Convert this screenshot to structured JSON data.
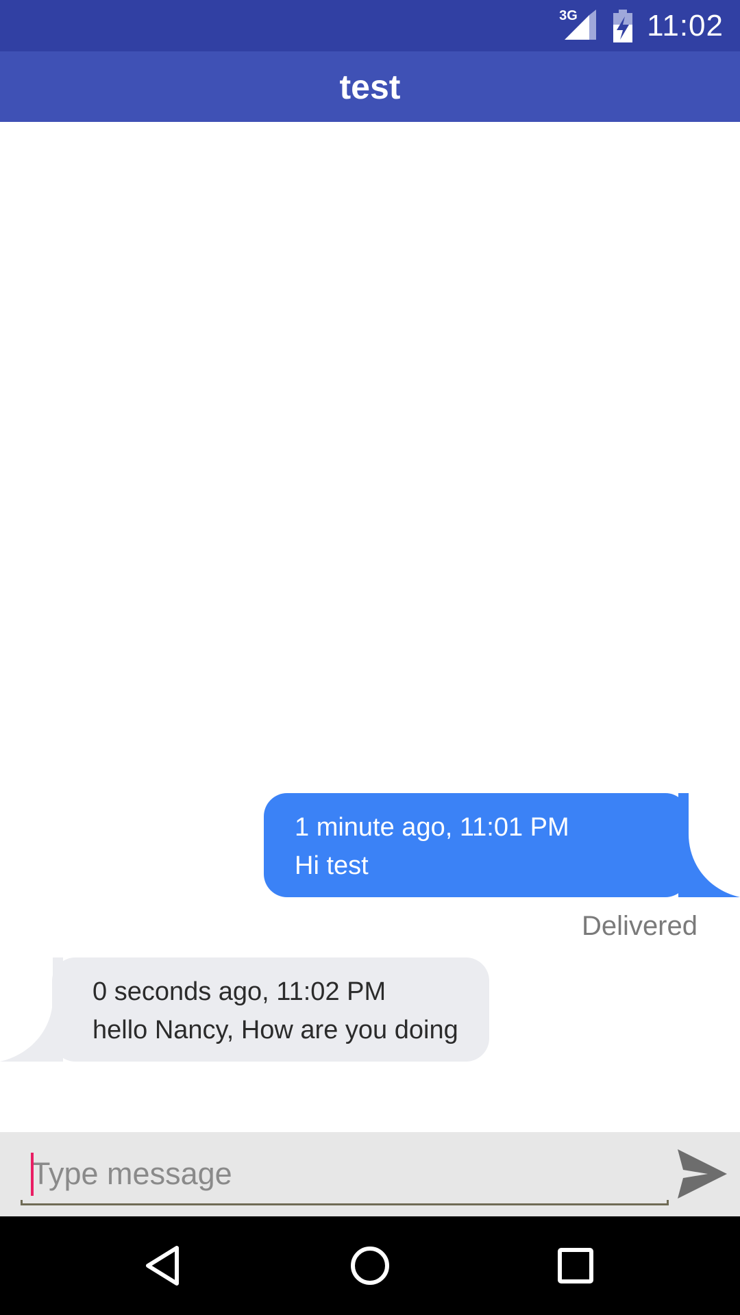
{
  "status_bar": {
    "network": "3G",
    "time": "11:02",
    "icons": [
      "signal-icon",
      "battery-charging-icon"
    ]
  },
  "app_bar": {
    "title": "test"
  },
  "messages": [
    {
      "direction": "outgoing",
      "timestamp": "1 minute ago, 11:01 PM",
      "text": "Hi test",
      "status": "Delivered"
    },
    {
      "direction": "incoming",
      "timestamp": "0 seconds ago, 11:02 PM",
      "text": "hello Nancy, How are you doing"
    }
  ],
  "composer": {
    "placeholder": "Type message",
    "value": "",
    "send_icon": "send-icon"
  },
  "nav_bar": {
    "icons": [
      "back-icon",
      "home-icon",
      "recents-icon"
    ]
  },
  "colors": {
    "status_bar": "#3140a3",
    "app_bar": "#3f51b5",
    "outgoing_bubble": "#3b82f6",
    "incoming_bubble": "#ebecf0",
    "composer_background": "#e7e7e7",
    "cursor": "#e91e63"
  }
}
